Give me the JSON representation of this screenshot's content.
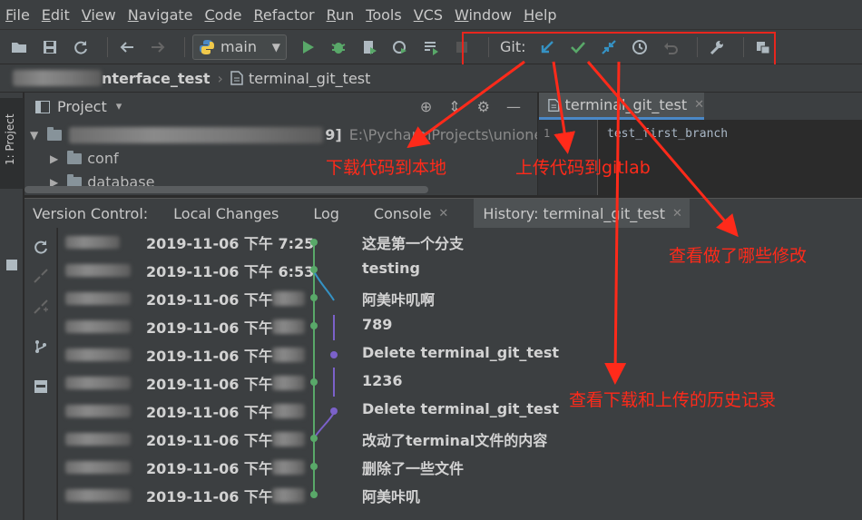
{
  "menu": [
    "File",
    "Edit",
    "View",
    "Navigate",
    "Code",
    "Refactor",
    "Run",
    "Tools",
    "VCS",
    "Window",
    "Help"
  ],
  "toolbar": {
    "branch": "main",
    "git_label": "Git:"
  },
  "breadcrumb": {
    "project": "nterface_test",
    "file": "terminal_git_test"
  },
  "left_strip": {
    "project_tab": "1: Project"
  },
  "project_panel": {
    "title": "Project",
    "dropdown": "▾",
    "root_suffix": "9]",
    "root_path": "E:\\PycharmProjects\\unione",
    "folders": [
      "conf",
      "database"
    ]
  },
  "editor": {
    "tab": "terminal_git_test",
    "line_number": "1",
    "code_line": "test_first_branch"
  },
  "version_control": {
    "title": "Version Control:",
    "tabs": [
      {
        "label": "Local Changes"
      },
      {
        "label": "Log"
      },
      {
        "label": "Console"
      },
      {
        "label": "History: terminal_git_test"
      }
    ],
    "commits": [
      {
        "date": "2019-11-06 下午 7:25",
        "message": "这是第一个分支"
      },
      {
        "date": "2019-11-06 下午 6:53",
        "message": "testing"
      },
      {
        "date": "2019-11-06 下午",
        "message": "阿美咔叽啊"
      },
      {
        "date": "2019-11-06 下午",
        "message": "789"
      },
      {
        "date": "2019-11-06 下午",
        "message": "Delete terminal_git_test"
      },
      {
        "date": "2019-11-06 下午",
        "message": "1236"
      },
      {
        "date": "2019-11-06 下午",
        "message": "Delete terminal_git_test"
      },
      {
        "date": "2019-11-06 下午",
        "message": "改动了terminal文件的内容"
      },
      {
        "date": "2019-11-06 下午",
        "message": "删除了一些文件"
      },
      {
        "date": "2019-11-06 下午",
        "message": "阿美咔叽"
      }
    ]
  },
  "annotations": {
    "pull": "下载代码到本地",
    "push": "上传代码到gitlab",
    "changes": "查看做了哪些修改",
    "history": "查看下载和上传的历史记录"
  },
  "colors": {
    "accent": "#4a88c7",
    "annotation_red": "#ff2a1a",
    "git_green": "#59a869",
    "git_blue": "#3592c4",
    "graph_purple": "#7b61c9"
  },
  "icons": [
    "open-folder-icon",
    "save-icon",
    "sync-icon",
    "back-arrow-icon",
    "forward-arrow-icon",
    "python-icon",
    "run-icon",
    "debug-icon",
    "coverage-icon",
    "profile-icon",
    "run-list-icon",
    "stop-icon",
    "update-project-icon",
    "commit-check-icon",
    "compare-icon",
    "history-clock-icon",
    "rollback-icon",
    "wrench-icon",
    "vcs-operations-icon"
  ]
}
